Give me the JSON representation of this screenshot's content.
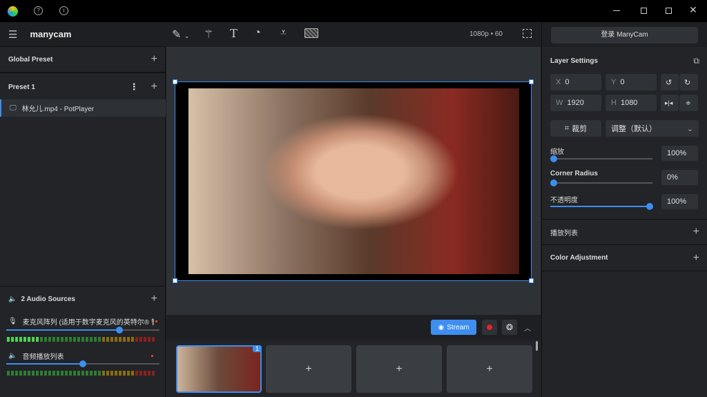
{
  "titlebar": {
    "icons": [
      "manycam-logo",
      "help-icon",
      "info-icon",
      "minimize-icon",
      "restore-icon",
      "maximize-icon",
      "close-icon"
    ]
  },
  "left": {
    "brand": "manycam",
    "global_preset": "Global Preset",
    "preset": "Preset 1",
    "source": "林允儿.mp4 - PotPlayer",
    "audio_title": "2 Audio Sources",
    "audio": [
      {
        "name": "麦克风阵列 (适用于数字麦克风的英特尔® 智能",
        "volume": 0.75
      },
      {
        "name": "音频播放列表",
        "volume": 0.5
      }
    ]
  },
  "toolbar": {
    "resolution": "1080p • 60",
    "tools": [
      "pen-icon",
      "magic-wand-icon",
      "text-icon",
      "timer-icon",
      "lower-third-icon",
      "chroma-key-icon"
    ]
  },
  "bottom": {
    "stream": "Stream",
    "thumb_badge": "1",
    "add": "+"
  },
  "right": {
    "login": "登录 ManyCam",
    "layer_settings": "Layer Settings",
    "x_label": "X",
    "x": "0",
    "y_label": "Y",
    "y": "0",
    "w_label": "W",
    "w": "1920",
    "h_label": "H",
    "h": "1080",
    "crop": "裁剪",
    "adjust": "调整（默认）",
    "scale_label": "缩放",
    "scale": "100%",
    "scale_value": 1.0,
    "corner_label": "Corner Radius",
    "corner": "0%",
    "corner_value": 0,
    "opacity_label": "不透明度",
    "opacity": "100%",
    "opacity_value": 1.0,
    "playlist": "播放列表",
    "color_adjust": "Color Adjustment"
  },
  "colors": {
    "accent": "#3d8ef0",
    "record": "#e0242f"
  }
}
